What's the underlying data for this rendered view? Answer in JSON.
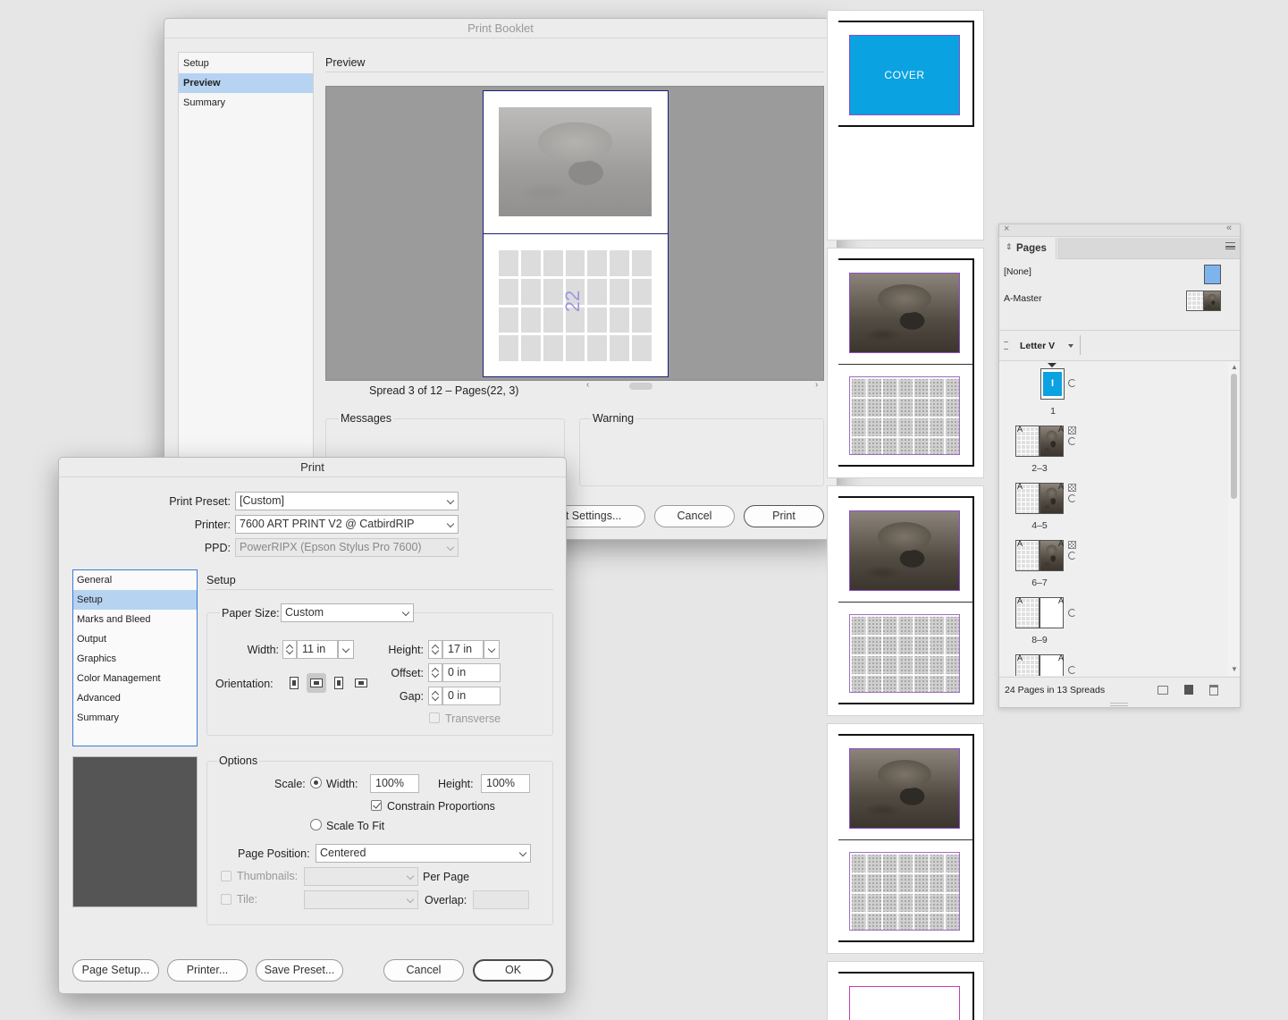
{
  "booklet": {
    "title": "Print Booklet",
    "nav": [
      "Setup",
      "Preview",
      "Summary"
    ],
    "section_title": "Preview",
    "spread_label": "Spread 3 of 12 – Pages(22, 3)",
    "page_number": "22",
    "messages_label": "Messages",
    "warning_label": "Warning",
    "print_settings_label": "Print Settings...",
    "cancel_label": "Cancel",
    "print_label": "Print"
  },
  "print": {
    "title": "Print",
    "preset_label": "Print Preset:",
    "preset_value": "[Custom]",
    "printer_label": "Printer:",
    "printer_value": "7600 ART PRINT V2 @ CatbirdRIP",
    "ppd_label": "PPD:",
    "ppd_value": "PowerRIPX (Epson Stylus Pro 7600)",
    "nav": [
      "General",
      "Setup",
      "Marks and Bleed",
      "Output",
      "Graphics",
      "Color Management",
      "Advanced",
      "Summary"
    ],
    "section_title": "Setup",
    "paper_size_label": "Paper Size:",
    "paper_size_value": "Custom",
    "width_label": "Width:",
    "width_value": "11 in",
    "height_label": "Height:",
    "height_value": "17 in",
    "offset_label": "Offset:",
    "offset_value": "0 in",
    "gap_label": "Gap:",
    "gap_value": "0 in",
    "orientation_label": "Orientation:",
    "transverse_label": "Transverse",
    "options_title": "Options",
    "scale_label": "Scale:",
    "scale_width_label": "Width:",
    "scale_width_value": "100%",
    "scale_height_label": "Height:",
    "scale_height_value": "100%",
    "constrain_label": "Constrain Proportions",
    "scale_to_fit_label": "Scale To Fit",
    "page_position_label": "Page Position:",
    "page_position_value": "Centered",
    "thumbnails_label": "Thumbnails:",
    "per_page_label": "Per Page",
    "tile_label": "Tile:",
    "overlap_label": "Overlap:",
    "page_setup_label": "Page Setup...",
    "printer_btn_label": "Printer...",
    "save_preset_label": "Save Preset...",
    "cancel_label": "Cancel",
    "ok_label": "OK"
  },
  "spreads_panel": {
    "cover_text": "COVER",
    "colors": {
      "cover": "#0aa2e0",
      "frame": "#8a4fc8"
    }
  },
  "pages_panel": {
    "title": "Pages",
    "masters": [
      "[None]",
      "A-Master"
    ],
    "size_label": "Letter V",
    "page_labels": [
      "1",
      "2–3",
      "4–5",
      "6–7",
      "8–9"
    ],
    "first_page_marker": "I",
    "master_letter": "A",
    "footer_text": "24 Pages in 13 Spreads"
  }
}
